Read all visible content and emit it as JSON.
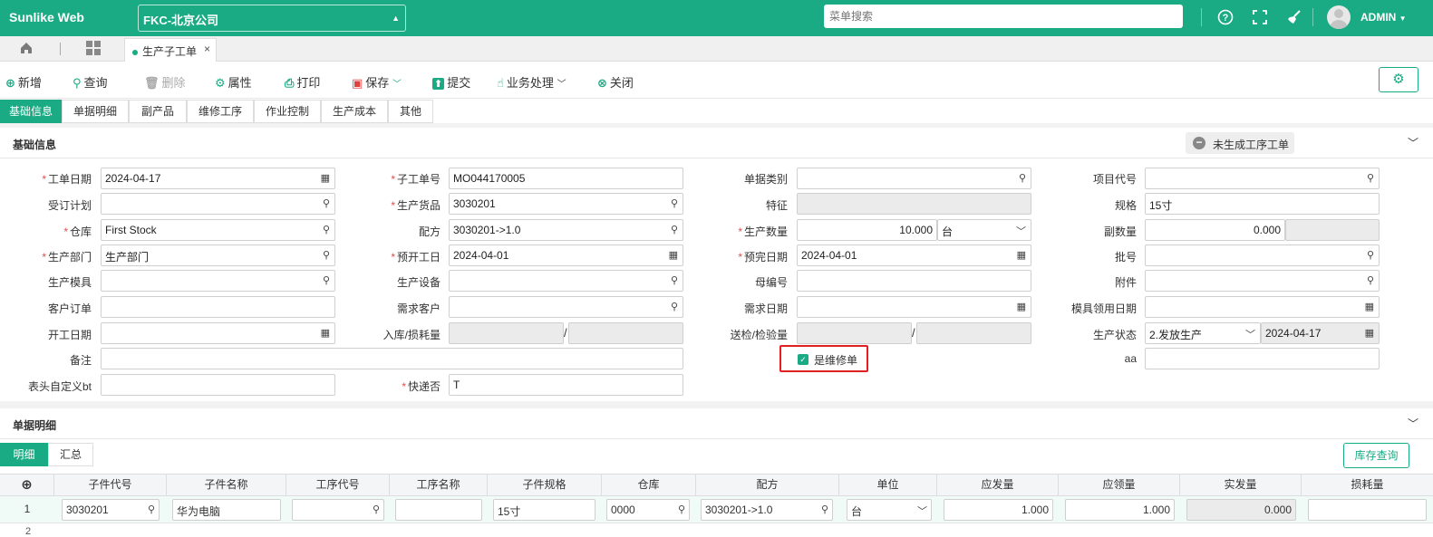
{
  "topbar": {
    "brand": "Sunlike Web",
    "company": "FKC-北京公司",
    "menu_search_placeholder": "菜单搜索",
    "user": "ADMIN",
    "accent": "#1aab84"
  },
  "tabs": {
    "open_doc": "生产子工单",
    "close": "×"
  },
  "toolbar": {
    "new": "新增",
    "query": "查询",
    "delete": "删除",
    "properties": "属性",
    "print": "打印",
    "save": "保存",
    "submit": "提交",
    "business": "业务处理",
    "close": "关闭"
  },
  "section_tabs": [
    "基础信息",
    "单据明细",
    "副产品",
    "维修工序",
    "作业控制",
    "生产成本",
    "其他"
  ],
  "basic": {
    "title": "基础信息",
    "status_chip": "未生成工序工单"
  },
  "form": {
    "col1": {
      "work_date_label": "工单日期",
      "work_date": "2024-04-17",
      "order_plan_label": "受订计划",
      "order_plan": "",
      "warehouse_label": "仓库",
      "warehouse": "First Stock",
      "dept_label": "生产部门",
      "dept": "生产部门",
      "mold_label": "生产模具",
      "mold": "",
      "cust_order_label": "客户订单",
      "cust_order": "",
      "start_date_label": "开工日期",
      "start_date": "",
      "remark_label": "备注",
      "remark": "",
      "header_custom_label": "表头自定义bt",
      "header_custom": ""
    },
    "col2": {
      "sub_no_label": "子工单号",
      "sub_no": "MO044170005",
      "product_label": "生产货品",
      "product": "3030201",
      "recipe_label": "配方",
      "recipe": "3030201->1.0",
      "plan_start_label": "预开工日",
      "plan_start": "2024-04-01",
      "equipment_label": "生产设备",
      "equipment": "",
      "demand_cust_label": "需求客户",
      "demand_cust": "",
      "in_loss_label": "入库/损耗量",
      "slash": "/",
      "express_label": "快递否",
      "express": "T"
    },
    "col3": {
      "doc_type_label": "单据类别",
      "doc_type": "",
      "feature_label": "特征",
      "feature": "",
      "qty_label": "生产数量",
      "qty": "10.000",
      "unit": "台",
      "plan_end_label": "预完日期",
      "plan_end": "2024-04-01",
      "parent_no_label": "母编号",
      "parent_no": "",
      "demand_date_label": "需求日期",
      "demand_date": "",
      "inspect_label": "送检/检验量",
      "slash": "/",
      "repair_label": "是维修单",
      "repair_checked": true
    },
    "col4": {
      "project_label": "项目代号",
      "project": "",
      "spec_label": "规格",
      "spec": "15寸",
      "sub_qty_label": "副数量",
      "sub_qty": "0.000",
      "batch_label": "批号",
      "batch": "",
      "attach_label": "附件",
      "attach": "",
      "mold_use_date_label": "模具领用日期",
      "mold_use_date": "",
      "status_label": "生产状态",
      "status": "2.发放生产",
      "status_date": "2024-04-17",
      "aa_label": "aa",
      "aa": ""
    }
  },
  "detail": {
    "title": "单据明细",
    "tabs": [
      "明细",
      "汇总"
    ],
    "stock_query": "库存查询",
    "add": "⊕",
    "columns": [
      "子件代号",
      "子件名称",
      "工序代号",
      "工序名称",
      "子件规格",
      "仓库",
      "配方",
      "单位",
      "应发量",
      "应领量",
      "实发量",
      "损耗量"
    ],
    "rows": [
      {
        "no": "1",
        "code": "3030201",
        "name": "华为电脑",
        "proc_code": "",
        "proc_name": "",
        "spec": "15寸",
        "wh": "0000",
        "recipe": "3030201->1.0",
        "unit": "台",
        "should_issue": "1.000",
        "should_take": "1.000",
        "actual": "0.000",
        "loss": ""
      }
    ],
    "next_row_no": "2"
  }
}
